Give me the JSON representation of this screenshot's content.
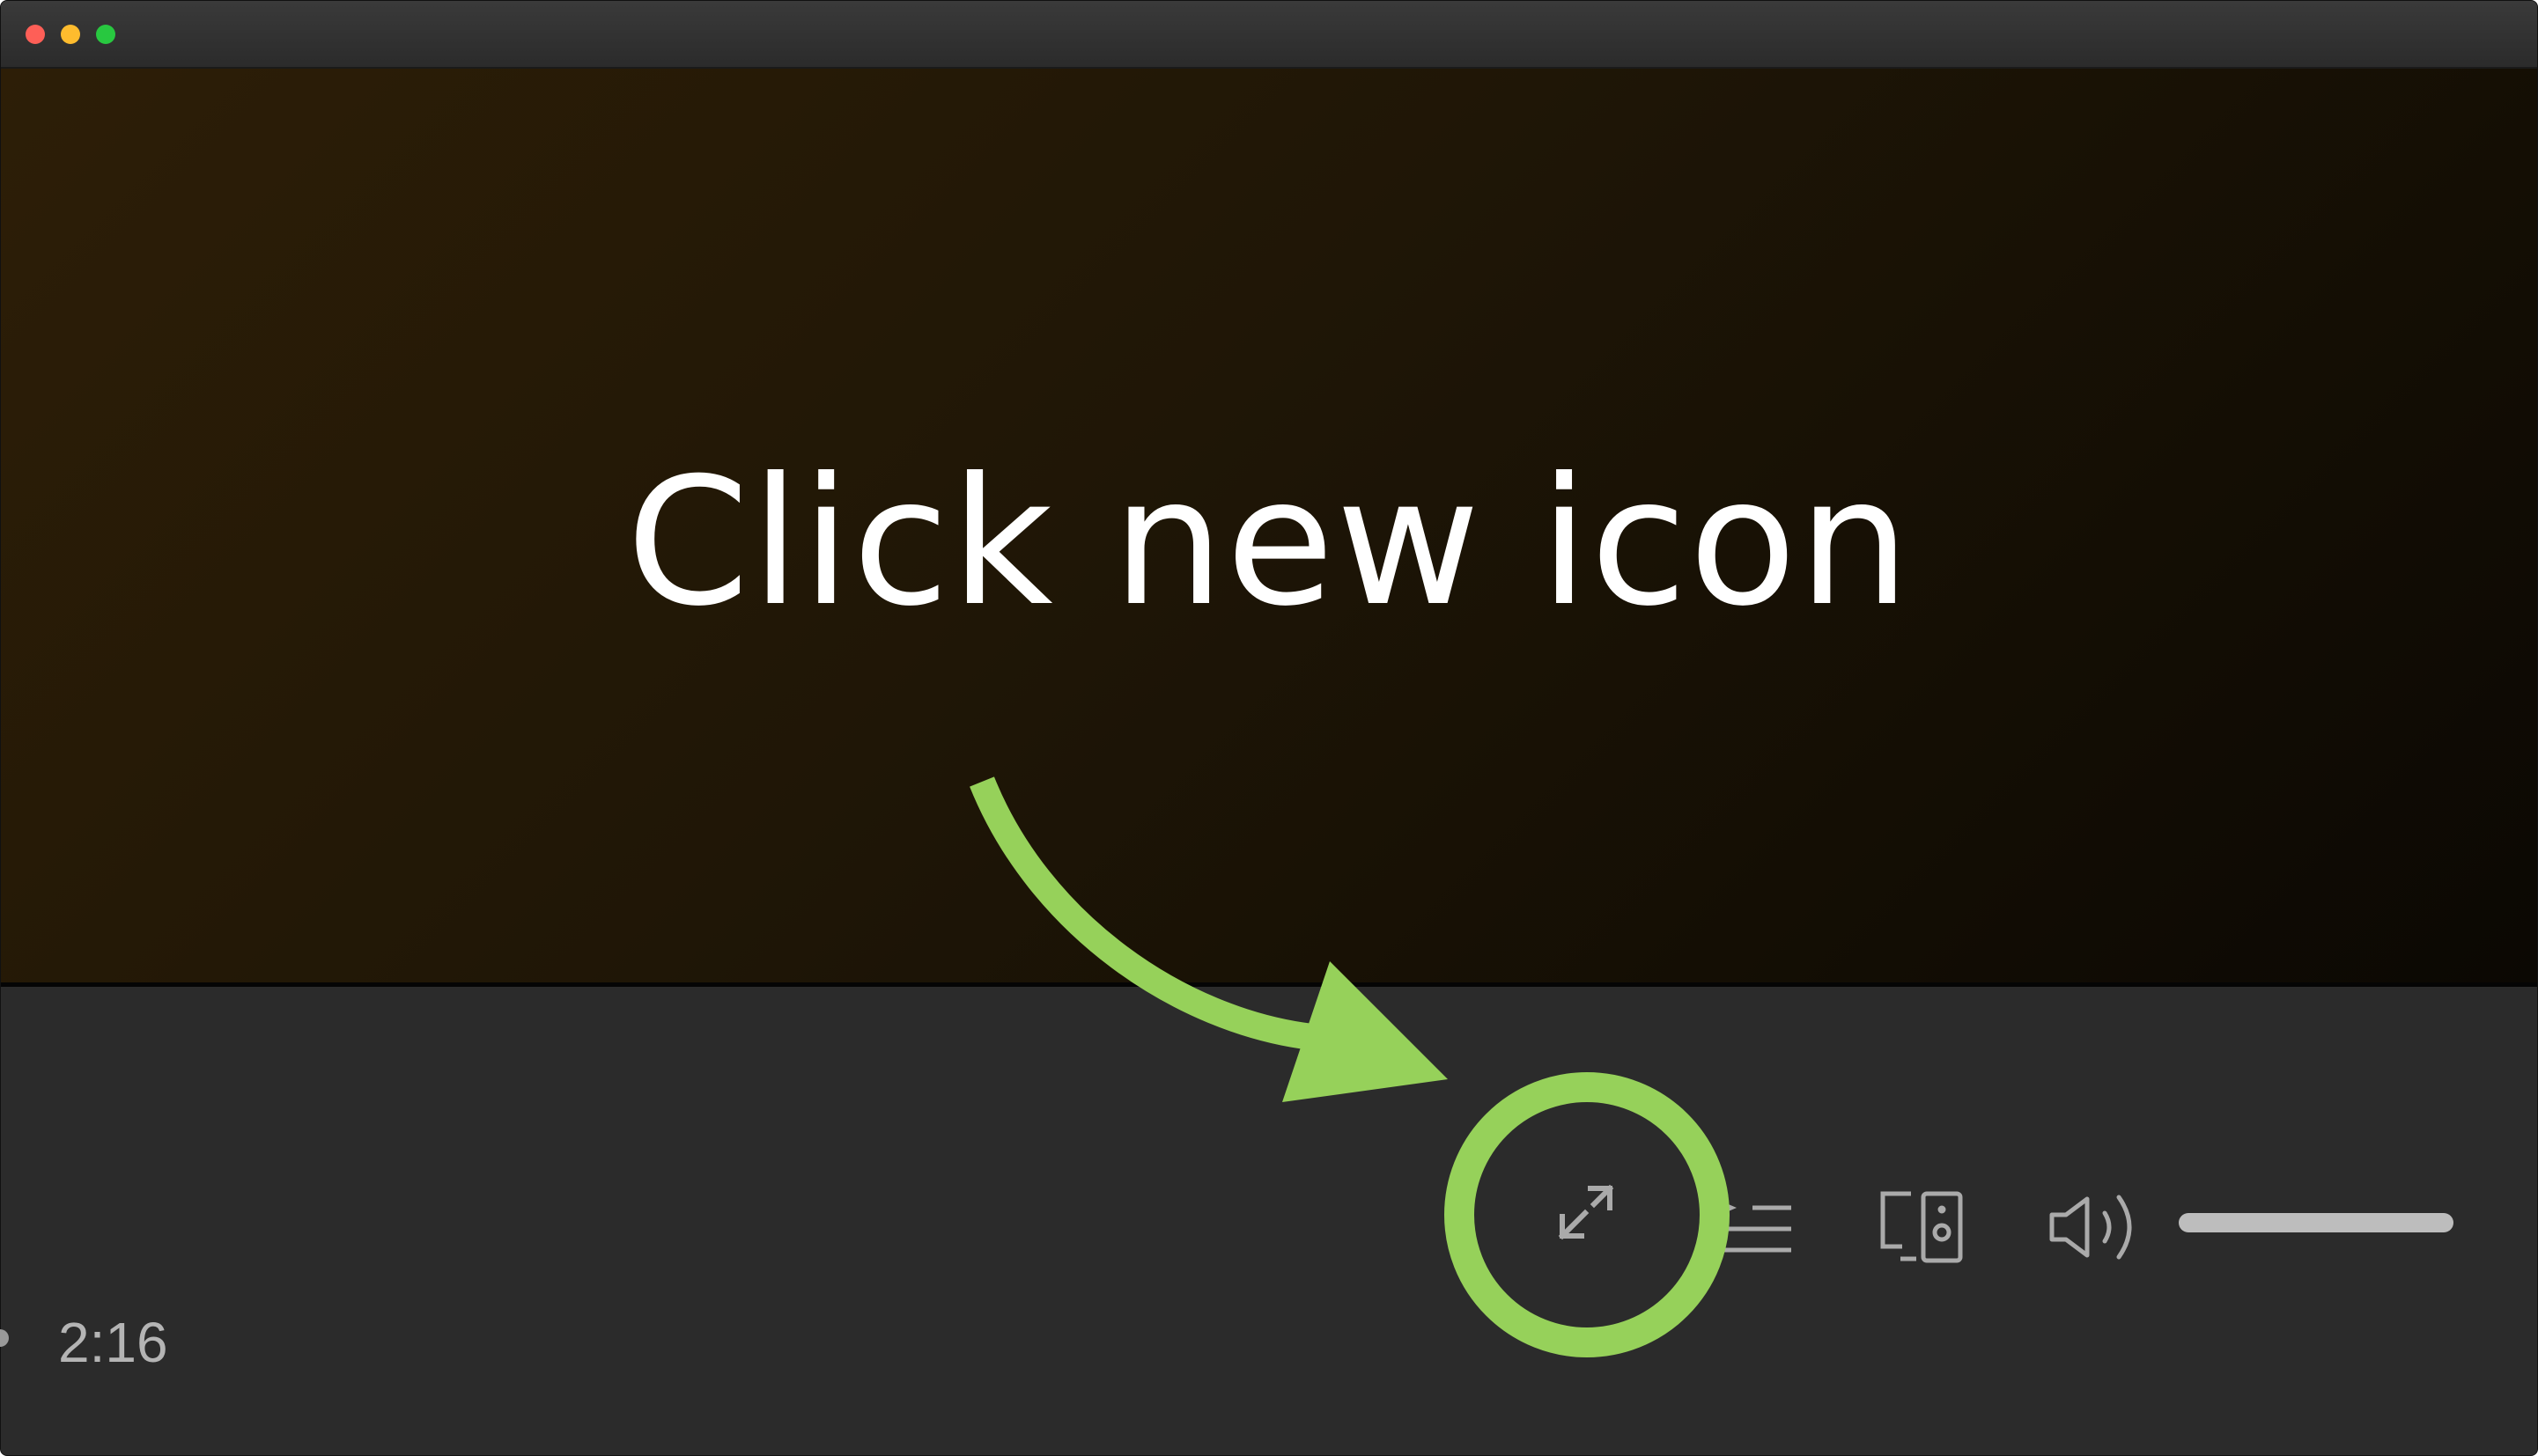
{
  "annotation": {
    "headline": "Click new icon",
    "accent_color": "#96d15a"
  },
  "player": {
    "elapsed_time": "2:16",
    "volume_fraction": 1.0,
    "icons": {
      "resize": "resize-expand-icon",
      "playlist": "playlist-icon",
      "airplay": "device-speaker-icon",
      "volume": "volume-icon"
    }
  }
}
